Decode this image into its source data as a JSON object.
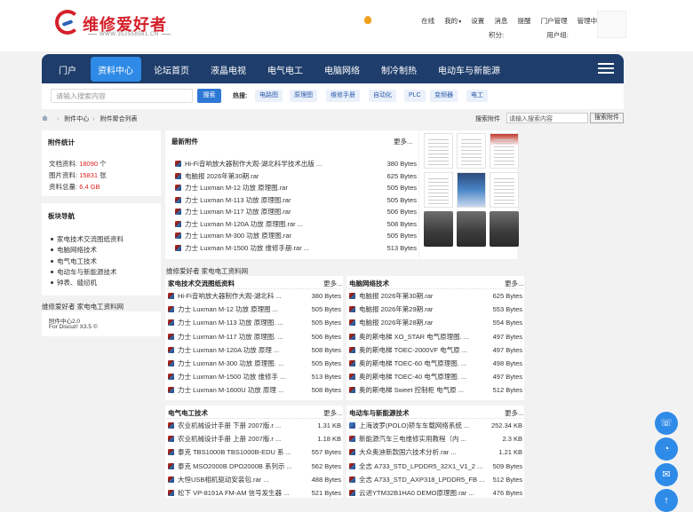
{
  "header": {
    "logo_title": "维修爱好者",
    "logo_url": "WWW.352558561.CN",
    "top_links": [
      "在线",
      "我的",
      "设置",
      "消息",
      "提醒",
      "门户管理",
      "管理中心",
      "退出"
    ],
    "points_label": "积分:",
    "usergroup_label": "用户组:"
  },
  "nav": {
    "items": [
      "门户",
      "资料中心",
      "论坛首页",
      "液晶电视",
      "电气电工",
      "电脑网络",
      "制冷制热",
      "电动车与新能源"
    ]
  },
  "search": {
    "placeholder": "请输入搜索内容",
    "button": "搜索",
    "hot_label": "热搜:",
    "hot_tags": [
      "电路图",
      "原理图",
      "维修手册",
      "自动化",
      "PLC",
      "变频器",
      "电工"
    ]
  },
  "breadcrumb": {
    "items": [
      "附件中心",
      "附件聚合列表"
    ],
    "search_label": "搜索附件",
    "search_value": "请输入搜索内容",
    "search_button": "搜索附件"
  },
  "stats": {
    "title": "附件统计",
    "docs_label": "文档资料:",
    "docs_value": "18090",
    "docs_unit": "个",
    "images_label": "图片资料:",
    "images_value": "15831",
    "images_unit": "张",
    "total_label": "资料总量:",
    "total_value": "6.4 GB"
  },
  "categories": {
    "title": "板块导航",
    "items": [
      "家电技术交流图纸资料",
      "电脑网络技术",
      "电气电工技术",
      "电动车与新能源技术",
      "钟表、缝纫机"
    ]
  },
  "footer_left": {
    "site": "维修爱好者 家电电工资料网",
    "version": "附件中心2.0",
    "powered": "For Discuz! X3.5 ©"
  },
  "latest": {
    "title": "最新附件",
    "more": "更多...",
    "items": [
      {
        "name": "Hi-Fi音响放大器制作大观-湖北科学技术出版 ...",
        "size": "380 Bytes"
      },
      {
        "name": "电脑报 2026年第30期.rar",
        "size": "625 Bytes"
      },
      {
        "name": "力士 Luxman M-12 功放 原理图.rar",
        "size": "505 Bytes"
      },
      {
        "name": "力士 Luxman M-113 功放 原理图.rar",
        "size": "505 Bytes"
      },
      {
        "name": "力士 Luxman M-117 功放 原理图.rar",
        "size": "506 Bytes"
      },
      {
        "name": "力士 Luxman M-120A 功放 原理图.rar ...",
        "size": "508 Bytes"
      },
      {
        "name": "力士 Luxman M-300 功放 原理图.rar",
        "size": "505 Bytes"
      },
      {
        "name": "力士 Luxman M-1500 功放 维修手册.rar ...",
        "size": "513 Bytes"
      }
    ]
  },
  "site_label": "维修爱好者 家电电工资料网",
  "sections": [
    {
      "title": "家电技术交流图纸资料",
      "more": "更多...",
      "items": [
        {
          "name": "Hi-Fi音响放大器制作大观-湖北科 ...",
          "size": "380 Bytes"
        },
        {
          "name": "力士 Luxman M-12 功放 原理图 ...",
          "size": "505 Bytes"
        },
        {
          "name": "力士 Luxman M-113 功放 原理图. ...",
          "size": "505 Bytes"
        },
        {
          "name": "力士 Luxman M-117 功放 原理图. ...",
          "size": "506 Bytes"
        },
        {
          "name": "力士 Luxman M-120A 功放 原理 ...",
          "size": "508 Bytes"
        },
        {
          "name": "力士 Luxman M-300 功放 原理图. ...",
          "size": "505 Bytes"
        },
        {
          "name": "力士 Luxman M-1500 功放 维修手 ...",
          "size": "513 Bytes"
        },
        {
          "name": "力士 Luxman M-1600U 功放 原理 ...",
          "size": "508 Bytes"
        }
      ]
    },
    {
      "title": "电脑网络技术",
      "more": "更多...",
      "items": [
        {
          "name": "电脑报 2026年第30期.rar",
          "size": "625 Bytes"
        },
        {
          "name": "电脑报 2026年第29期.rar",
          "size": "553 Bytes"
        },
        {
          "name": "电脑报 2026年第28期.rar",
          "size": "554 Bytes"
        },
        {
          "name": "奥的斯电梯 XO_STAR 电气原理图. ...",
          "size": "497 Bytes"
        },
        {
          "name": "奥的斯电梯 TOEC-2000VF 电气原 ...",
          "size": "497 Bytes"
        },
        {
          "name": "奥的斯电梯 TOEC-60 电气原理图. ...",
          "size": "498 Bytes"
        },
        {
          "name": "奥的斯电梯 TOEC-40 电气原理图. ...",
          "size": "497 Bytes"
        },
        {
          "name": "奥的斯电梯 Sweet 控制柜 电气原 ...",
          "size": "512 Bytes"
        }
      ]
    },
    {
      "title": "电气电工技术",
      "more": "更多...",
      "items": [
        {
          "name": "农业机械设计手册 下册 2007版.r ...",
          "size": "1.31 KB"
        },
        {
          "name": "农业机械设计手册 上册 2007版.r ...",
          "size": "1.18 KB"
        },
        {
          "name": "泰克 TBS1000B TBS1000B-EDU 系 ...",
          "size": "557 Bytes"
        },
        {
          "name": "泰克 MSO2000B DPO2000B 系列示 ...",
          "size": "562 Bytes"
        },
        {
          "name": "大恒USB相机驱动安装包.rar ...",
          "size": "488 Bytes"
        },
        {
          "name": "松下 VP-8191A FM-AM 信号发生器 ...",
          "size": "521 Bytes"
        }
      ]
    },
    {
      "title": "电动车与新能源技术",
      "more": "更多...",
      "items": [
        {
          "name": "上海波罗(POLO)轿车车载网络系统 ...",
          "size": "252.34 KB"
        },
        {
          "name": "新能源汽车三电维修实用教程（内 ...",
          "size": "2.3 KB"
        },
        {
          "name": "大众奥迪新款国六技术分析.rar ...",
          "size": "1.21 KB"
        },
        {
          "name": "全志 A733_STD_LPDDR5_32X1_V1_2 ...",
          "size": "509 Bytes"
        },
        {
          "name": "全志 A733_STD_AXP318_LPDDR5_FB ...",
          "size": "512 Bytes"
        },
        {
          "name": "云进YTM32B1HA0 DEMO原理图.rar ...",
          "size": "476 Bytes"
        }
      ]
    }
  ],
  "floating_buttons": [
    "phone-icon",
    "wechat-icon",
    "chat-icon",
    "back-to-top-icon"
  ]
}
